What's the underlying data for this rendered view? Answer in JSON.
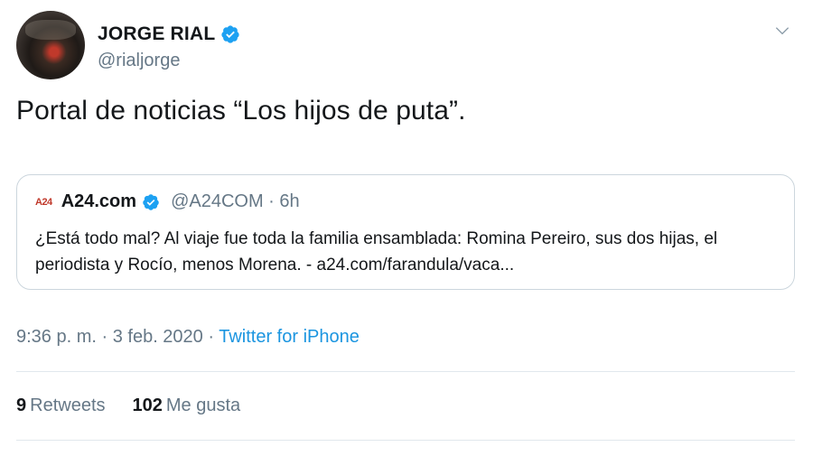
{
  "author": {
    "display_name": "JORGE RIAL",
    "handle": "@rialjorge"
  },
  "tweet": {
    "text": "Portal de noticias “Los hijos de puta”."
  },
  "quoted": {
    "logo_text": "A24",
    "name": "A24.com",
    "handle_time": "@A24COM · 6h",
    "text": "¿Está todo mal? Al viaje fue toda la familia ensamblada: Romina Pereiro, sus dos hijas, el periodista y Rocío, menos Morena.  - a24.com/farandula/vaca..."
  },
  "meta": {
    "timestamp": "9:36 p. m. · 3 feb. 2020 · ",
    "source": "Twitter for iPhone"
  },
  "stats": {
    "retweets_count": "9",
    "retweets_label": "Retweets",
    "likes_count": "102",
    "likes_label": "Me gusta"
  },
  "colors": {
    "verified": "#1da1f2",
    "link": "#1b95e0",
    "secondary_text": "#657786"
  }
}
